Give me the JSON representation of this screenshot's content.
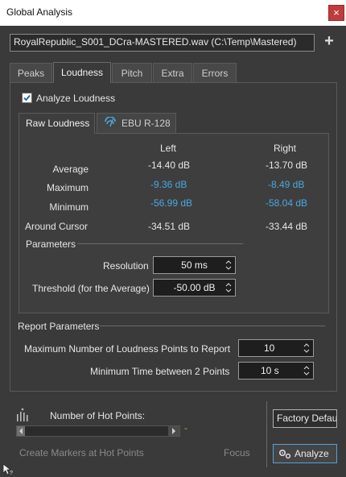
{
  "window": {
    "title": "Global Analysis",
    "close_glyph": "×"
  },
  "file": {
    "selected": "RoyalRepublic_S001_DCra-MASTERED.wav (C:\\Temp\\Mastered)",
    "add_glyph": "+"
  },
  "tabs": [
    {
      "label": "Peaks"
    },
    {
      "label": "Loudness"
    },
    {
      "label": "Pitch"
    },
    {
      "label": "Extra"
    },
    {
      "label": "Errors"
    }
  ],
  "active_tab": "Loudness",
  "analyze_loudness": {
    "label": "Analyze Loudness",
    "checked": true
  },
  "subtabs": [
    {
      "label": "Raw Loudness"
    },
    {
      "label": "EBU R-128"
    }
  ],
  "columns": {
    "left": "Left",
    "right": "Right"
  },
  "rows": [
    {
      "label": "Average",
      "left": "-14.40 dB",
      "right": "-13.70 dB",
      "link": false
    },
    {
      "label": "Maximum",
      "left": "-9.36 dB",
      "right": "-8.49 dB",
      "link": true
    },
    {
      "label": "Minimum",
      "left": "-56.99 dB",
      "right": "-58.04 dB",
      "link": true
    },
    {
      "label": "Around Cursor",
      "left": "-34.51 dB",
      "right": "-33.44 dB",
      "link": false
    }
  ],
  "parameters": {
    "title": "Parameters",
    "resolution_label": "Resolution",
    "resolution_value": "50 ms",
    "threshold_label": "Threshold (for the Average)",
    "threshold_value": "-50.00 dB"
  },
  "report": {
    "title": "Report Parameters",
    "max_points_label": "Maximum Number of Loudness Points to Report",
    "max_points_value": "10",
    "min_time_label": "Minimum Time between 2 Points",
    "min_time_value": "10 s"
  },
  "hot_points": {
    "label": "Number of Hot Points:",
    "value": "-",
    "markers_label": "Create Markers at Hot Points",
    "focus_label": "Focus"
  },
  "buttons": {
    "factory_defaults": "Factory Defaults",
    "analyze": "Analyze"
  },
  "colors": {
    "accent_blue": "#4aa8e0",
    "close_red": "#c03c3c",
    "background": "#3a3a3a"
  },
  "icons": [
    "close-icon",
    "plus-icon",
    "ebu-meter-icon",
    "spin-arrows-icon",
    "hot-points-icon",
    "gears-icon",
    "cursor-help-icon",
    "checkmark-icon"
  ]
}
